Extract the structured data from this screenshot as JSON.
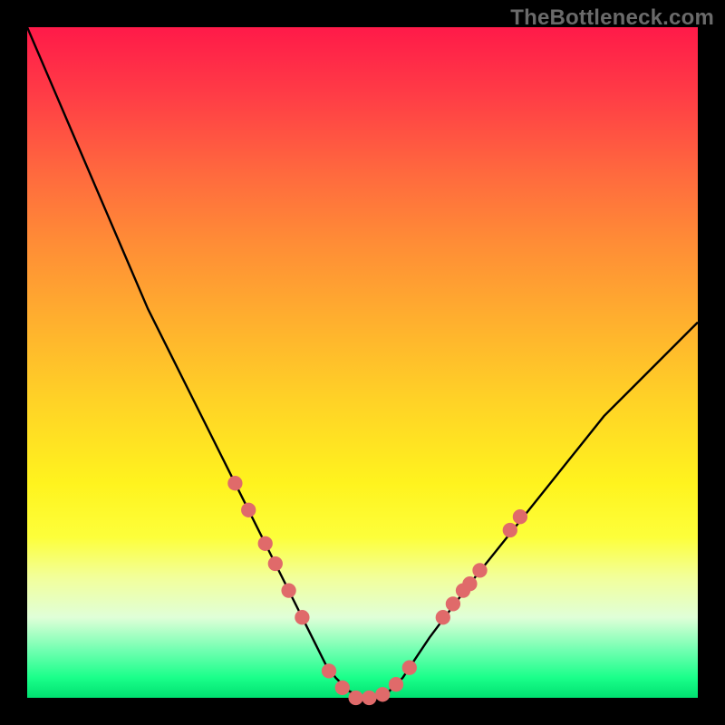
{
  "watermark": "TheBottleneck.com",
  "chart_data": {
    "type": "line",
    "title": "",
    "xlabel": "",
    "ylabel": "",
    "xlim": [
      0,
      100
    ],
    "ylim": [
      0,
      100
    ],
    "grid": false,
    "series": [
      {
        "name": "bottleneck-curve",
        "color": "#000000",
        "x": [
          0,
          3,
          6,
          9,
          12,
          15,
          18,
          21,
          24,
          27,
          29,
          31,
          33,
          35,
          37,
          39,
          41,
          43,
          44.5,
          46,
          48,
          50,
          52,
          54,
          56,
          58,
          60,
          63,
          66,
          70,
          74,
          78,
          82,
          86,
          90,
          94,
          98,
          100
        ],
        "y": [
          100,
          93,
          86,
          79,
          72,
          65,
          58,
          52,
          46,
          40,
          36,
          32,
          28,
          24,
          20,
          16,
          12,
          8,
          5,
          3,
          1,
          0,
          0,
          1,
          3,
          6,
          9,
          13,
          17,
          22,
          27,
          32,
          37,
          42,
          46,
          50,
          54,
          56
        ]
      }
    ],
    "markers": {
      "name": "highlight-dots",
      "color": "#e06a6a",
      "radius_percent": 1.1,
      "points": [
        {
          "x": 31,
          "y": 32
        },
        {
          "x": 33,
          "y": 28
        },
        {
          "x": 35.5,
          "y": 23
        },
        {
          "x": 37,
          "y": 20
        },
        {
          "x": 39,
          "y": 16
        },
        {
          "x": 41,
          "y": 12
        },
        {
          "x": 45,
          "y": 4
        },
        {
          "x": 47,
          "y": 1.5
        },
        {
          "x": 49,
          "y": 0
        },
        {
          "x": 51,
          "y": 0
        },
        {
          "x": 53,
          "y": 0.5
        },
        {
          "x": 55,
          "y": 2
        },
        {
          "x": 57,
          "y": 4.5
        },
        {
          "x": 62,
          "y": 12
        },
        {
          "x": 63.5,
          "y": 14
        },
        {
          "x": 65,
          "y": 16
        },
        {
          "x": 66,
          "y": 17
        },
        {
          "x": 67.5,
          "y": 19
        },
        {
          "x": 72,
          "y": 25
        },
        {
          "x": 73.5,
          "y": 27
        }
      ]
    }
  }
}
